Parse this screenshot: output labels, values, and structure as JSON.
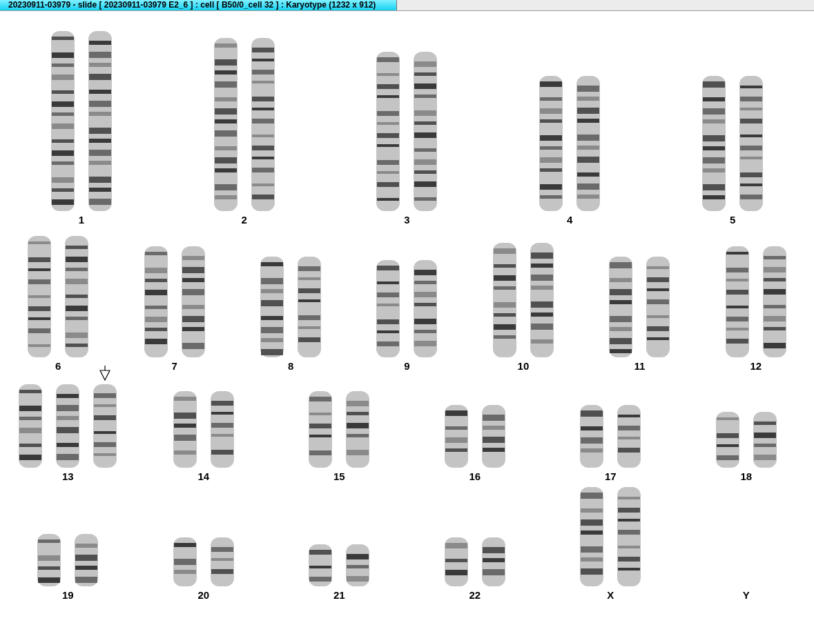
{
  "window": {
    "title": "20230911-03979 - slide [ 20230911-03979 E2_6 ] : cell [ B50/0_cell 32 ] : Karyotype  (1232 x 912)"
  },
  "rows": [
    {
      "groups": [
        {
          "label": "1",
          "homologs": [
            {
              "marked": false
            },
            {
              "marked": false
            }
          ]
        },
        {
          "label": "2",
          "homologs": [
            {
              "marked": false
            },
            {
              "marked": false
            }
          ]
        },
        {
          "label": "3",
          "homologs": [
            {
              "marked": false
            },
            {
              "marked": false
            }
          ]
        },
        {
          "label": "4",
          "homologs": [
            {
              "marked": false
            },
            {
              "marked": false
            }
          ]
        },
        {
          "label": "5",
          "homologs": [
            {
              "marked": false
            },
            {
              "marked": false
            }
          ]
        }
      ]
    },
    {
      "groups": [
        {
          "label": "6",
          "homologs": [
            {
              "marked": false
            },
            {
              "marked": false
            }
          ]
        },
        {
          "label": "7",
          "homologs": [
            {
              "marked": false
            },
            {
              "marked": false
            }
          ]
        },
        {
          "label": "8",
          "homologs": [
            {
              "marked": false
            },
            {
              "marked": false
            }
          ]
        },
        {
          "label": "9",
          "homologs": [
            {
              "marked": false
            },
            {
              "marked": false
            }
          ]
        },
        {
          "label": "10",
          "homologs": [
            {
              "marked": false
            },
            {
              "marked": false
            }
          ]
        },
        {
          "label": "11",
          "homologs": [
            {
              "marked": false
            },
            {
              "marked": false
            }
          ]
        },
        {
          "label": "12",
          "homologs": [
            {
              "marked": false
            },
            {
              "marked": false
            }
          ]
        }
      ]
    },
    {
      "groups": [
        {
          "label": "13",
          "homologs": [
            {
              "marked": false
            },
            {
              "marked": false
            },
            {
              "marked": true
            }
          ]
        },
        {
          "label": "14",
          "homologs": [
            {
              "marked": false
            },
            {
              "marked": false
            }
          ]
        },
        {
          "label": "15",
          "homologs": [
            {
              "marked": false
            },
            {
              "marked": false
            }
          ]
        },
        {
          "label": "16",
          "homologs": [
            {
              "marked": false
            },
            {
              "marked": false
            }
          ]
        },
        {
          "label": "17",
          "homologs": [
            {
              "marked": false
            },
            {
              "marked": false
            }
          ]
        },
        {
          "label": "18",
          "homologs": [
            {
              "marked": false
            },
            {
              "marked": false
            }
          ]
        }
      ]
    },
    {
      "groups": [
        {
          "label": "19",
          "homologs": [
            {
              "marked": false
            },
            {
              "marked": false
            }
          ]
        },
        {
          "label": "20",
          "homologs": [
            {
              "marked": false
            },
            {
              "marked": false
            }
          ]
        },
        {
          "label": "21",
          "homologs": [
            {
              "marked": false
            },
            {
              "marked": false
            }
          ]
        },
        {
          "label": "22",
          "homologs": [
            {
              "marked": false
            },
            {
              "marked": false
            }
          ]
        },
        {
          "label": "X",
          "homologs": [
            {
              "marked": false
            },
            {
              "marked": false
            }
          ]
        },
        {
          "label": "Y"
        }
      ]
    }
  ]
}
